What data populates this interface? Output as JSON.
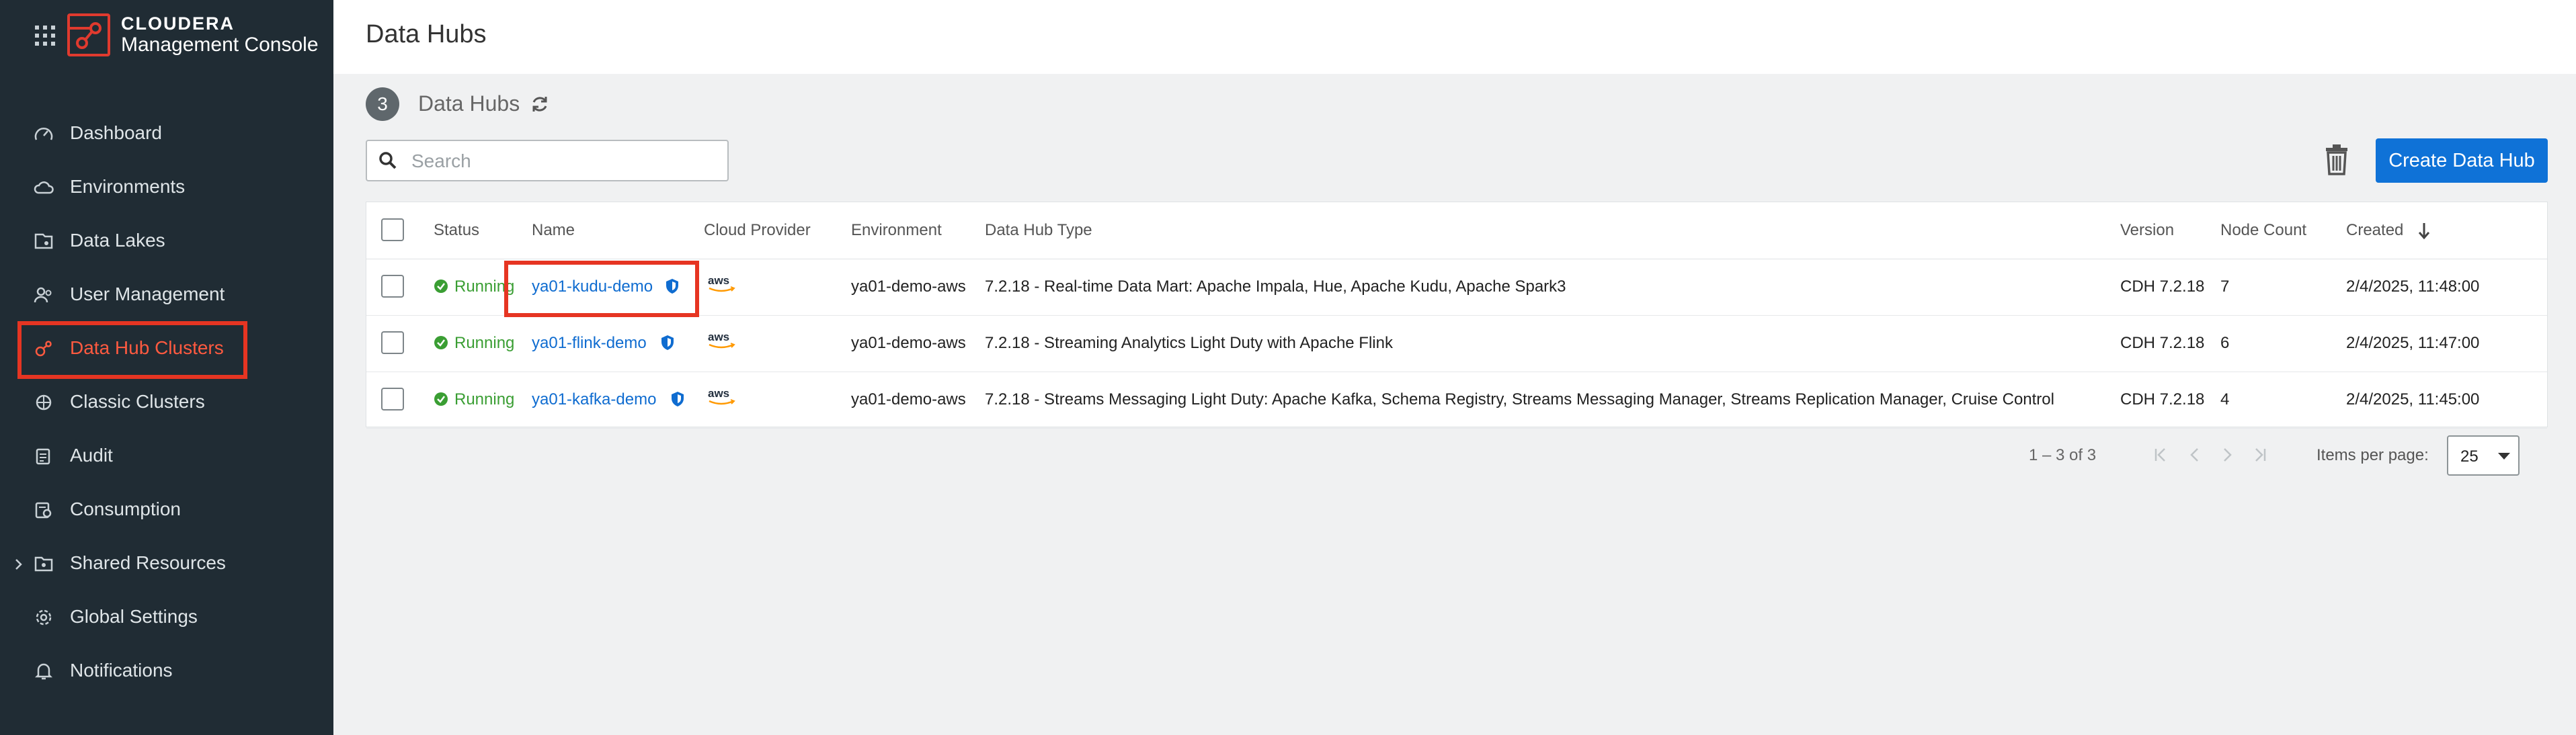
{
  "brand": {
    "line1": "CLOUDERA",
    "line2": "Management Console",
    "accent": "#e03a2e"
  },
  "sidebar": {
    "items": [
      {
        "label": "Dashboard",
        "icon": "dashboard-gauge-icon"
      },
      {
        "label": "Environments",
        "icon": "cloud-icon"
      },
      {
        "label": "Data Lakes",
        "icon": "data-lake-icon"
      },
      {
        "label": "User Management",
        "icon": "users-icon"
      },
      {
        "label": "Data Hub Clusters",
        "icon": "data-hub-icon",
        "active": true
      },
      {
        "label": "Classic Clusters",
        "icon": "classic-clusters-icon"
      },
      {
        "label": "Audit",
        "icon": "audit-icon"
      },
      {
        "label": "Consumption",
        "icon": "consumption-icon"
      },
      {
        "label": "Shared Resources",
        "icon": "folder-icon",
        "expandable": true
      },
      {
        "label": "Global Settings",
        "icon": "gear-icon"
      },
      {
        "label": "Notifications",
        "icon": "bell-icon"
      }
    ]
  },
  "header": {
    "title": "Data Hubs"
  },
  "summary": {
    "count": "3",
    "label": "Data Hubs"
  },
  "search": {
    "placeholder": "Search",
    "value": ""
  },
  "actions": {
    "create_label": "Create Data Hub"
  },
  "table": {
    "columns": [
      "Status",
      "Name",
      "Cloud Provider",
      "Environment",
      "Data Hub Type",
      "Version",
      "Node Count",
      "Created"
    ],
    "sort": {
      "column": "Created",
      "direction": "descending"
    },
    "rows": [
      {
        "status": "Running",
        "name": "ya01-kudu-demo",
        "provider": "aws",
        "environment": "ya01-demo-aws",
        "type": "7.2.18 - Real-time Data Mart: Apache Impala, Hue, Apache Kudu, Apache Spark3",
        "version": "CDH 7.2.18",
        "nodes": "7",
        "created": "2/4/2025, 11:48:00"
      },
      {
        "status": "Running",
        "name": "ya01-flink-demo",
        "provider": "aws",
        "environment": "ya01-demo-aws",
        "type": "7.2.18 - Streaming Analytics Light Duty with Apache Flink",
        "version": "CDH 7.2.18",
        "nodes": "6",
        "created": "2/4/2025, 11:47:00"
      },
      {
        "status": "Running",
        "name": "ya01-kafka-demo",
        "provider": "aws",
        "environment": "ya01-demo-aws",
        "type": "7.2.18 - Streams Messaging Light Duty: Apache Kafka, Schema Registry, Streams Messaging Manager, Streams Replication Manager, Cruise Control",
        "version": "CDH 7.2.18",
        "nodes": "4",
        "created": "2/4/2025, 11:45:00"
      }
    ]
  },
  "pagination": {
    "range": "1 – 3 of 3",
    "items_per_page_label": "Items per page:",
    "items_per_page": "25"
  },
  "colors": {
    "sidebar_bg": "#202c34",
    "active": "#ff5a40",
    "link": "#0f6cd0",
    "running": "#3a9e33",
    "primary_button": "#0f72d7",
    "highlight": "#e63522"
  }
}
